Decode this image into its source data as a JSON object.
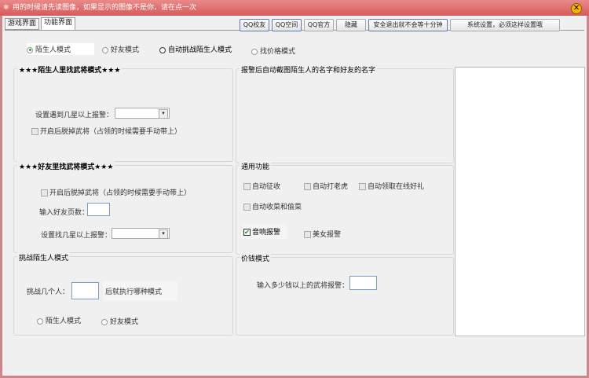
{
  "title": "用的时候请先读图像，如果显示的图像不是你，请在点一次",
  "tabs": [
    "游戏界面",
    "功能界面"
  ],
  "buttons": [
    "QQ校友",
    "QQ空间",
    "QQ官方",
    "隐藏",
    "安全退出就不会等十分钟",
    "系统设置，必须这样设置哦"
  ],
  "modes": [
    {
      "label": "陌生人模式",
      "checked": true
    },
    {
      "label": "好友模式",
      "checked": false
    },
    {
      "label": "自动挑战陌生人模式",
      "checked": false
    },
    {
      "label": "找价格模式",
      "checked": false
    }
  ],
  "stranger": {
    "title": "★★★陌生人里找武将模式★★★",
    "star_label": "设置遇到几星以上报警：",
    "star_value": "",
    "remove_label": "开启后脱掉武将（占领的时候需要手动带上）"
  },
  "friend": {
    "title": "★★★好友里找武将模式★★★",
    "remove_label": "开启后脱掉武将（占领的时候需要手动带上）",
    "pages_label": "输入好友页数：",
    "pages_value": "",
    "star_label": "设置找几星以上报警：",
    "star_value": ""
  },
  "challenge": {
    "title": "挑战陌生人模式",
    "count_label": "挑战几个人：",
    "count_value": "",
    "after_label": "后就执行哪种模式",
    "options": [
      "陌生人模式",
      "好友模式"
    ]
  },
  "screenshot": {
    "title": "报警后自动截图陌生人的名字和好友的名字"
  },
  "general": {
    "title": "通用功能",
    "items": [
      {
        "label": "自动征收",
        "checked": false
      },
      {
        "label": "自动打老虎",
        "checked": false
      },
      {
        "label": "自动领取在线好礼",
        "checked": false
      },
      {
        "label": "自动收菜和偷菜",
        "checked": false
      },
      {
        "label": "音响报警",
        "checked": true
      },
      {
        "label": "美女报警",
        "checked": false
      }
    ]
  },
  "price": {
    "title": "价钱模式",
    "label": "输入多少钱以上的武将报警：",
    "value": ""
  },
  "colors": {
    "titlebar": "#d65a5a",
    "accent": "#5a7ca8"
  }
}
